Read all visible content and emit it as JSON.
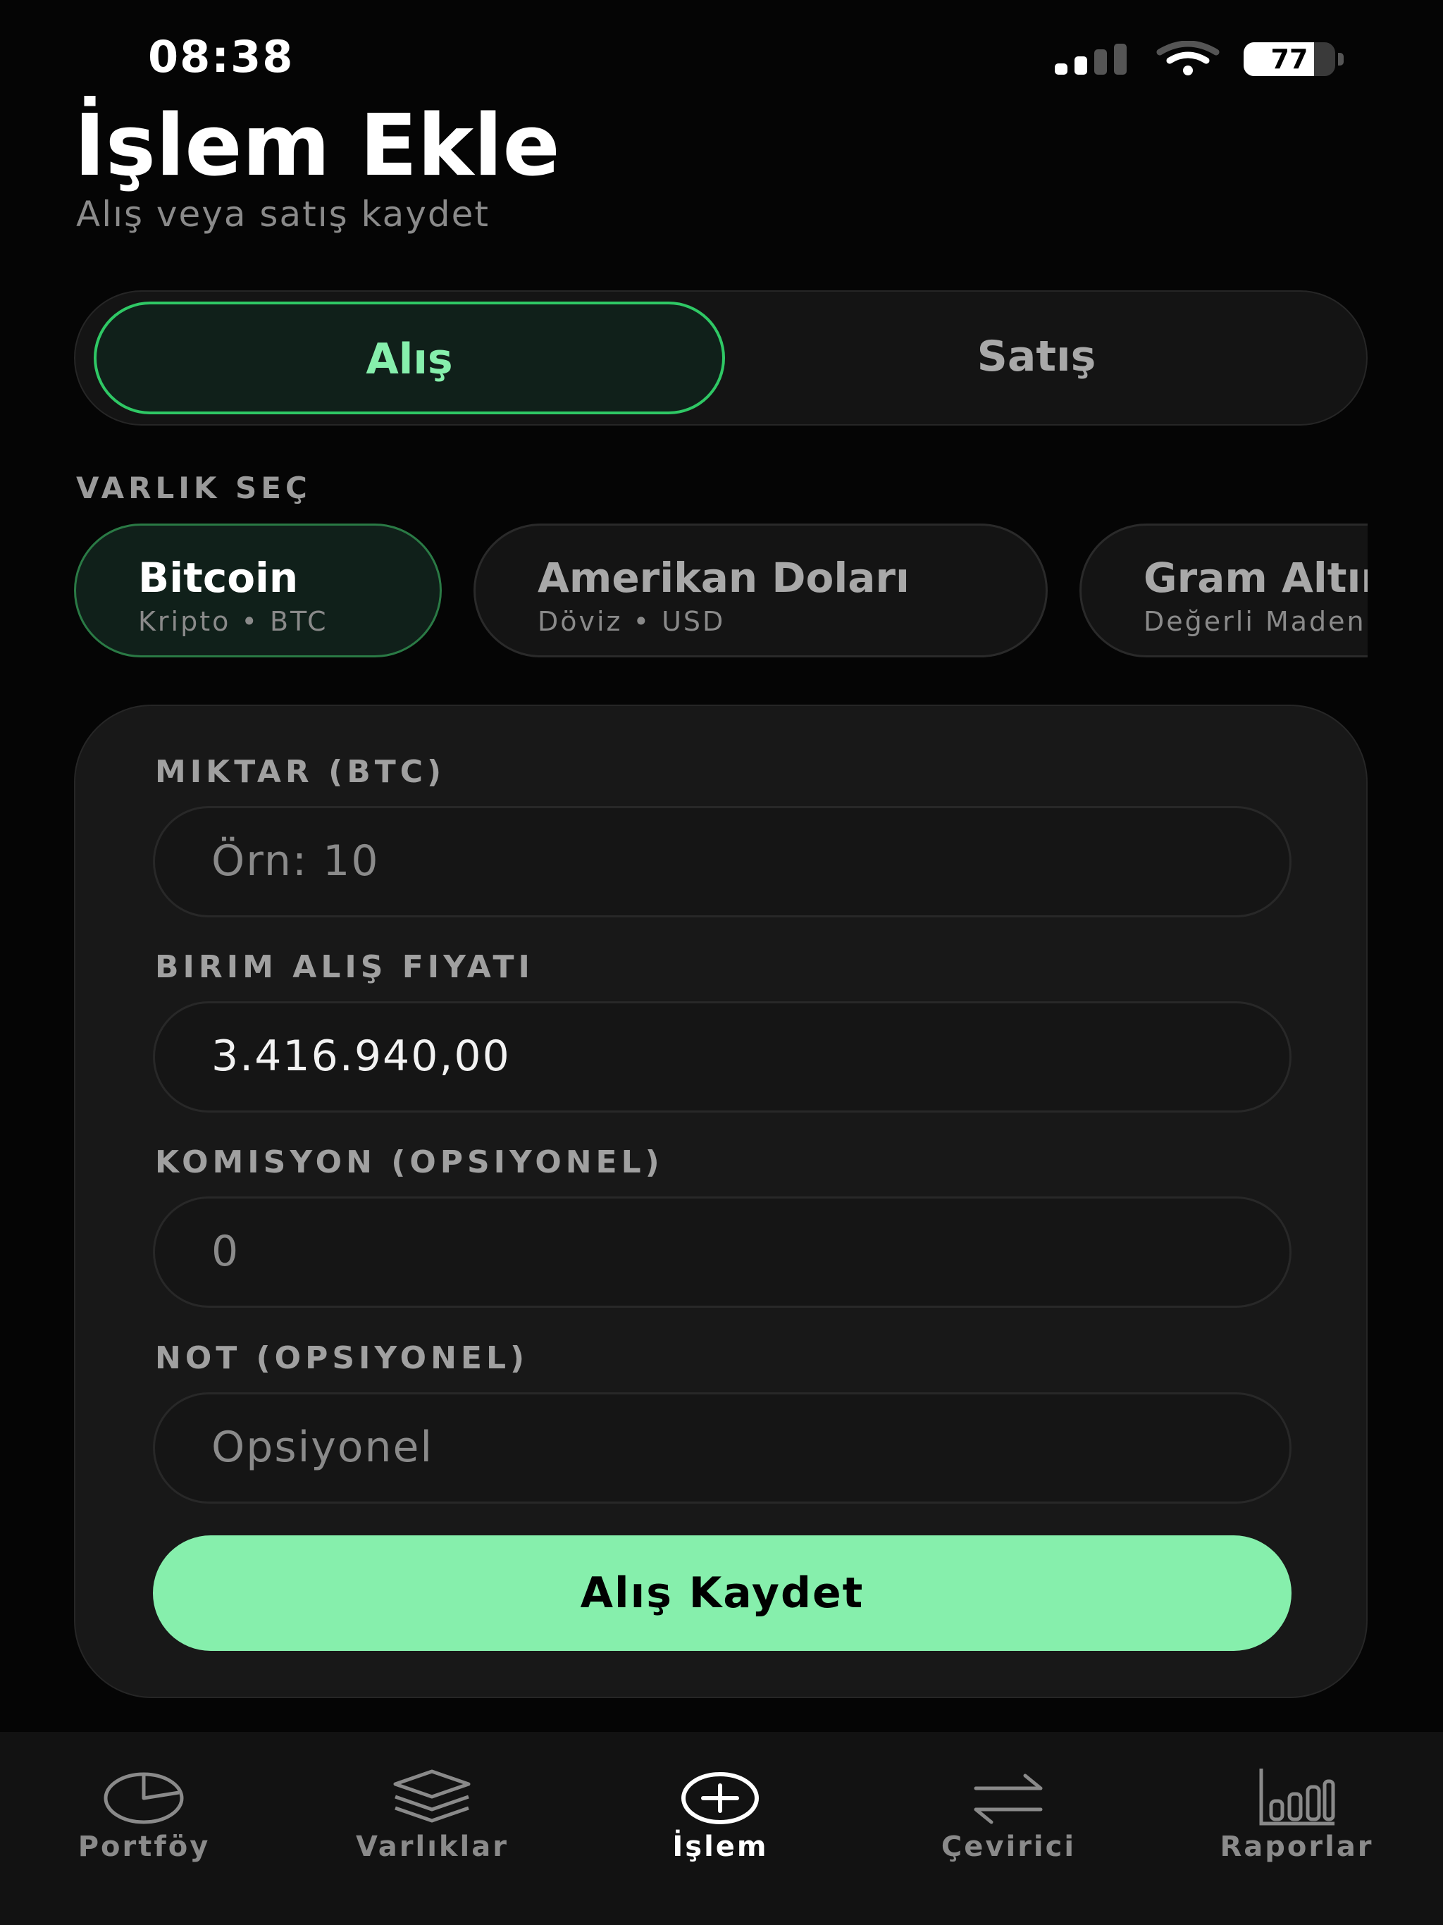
{
  "status_bar": {
    "time": "08:38",
    "battery": "77",
    "battery_level": 0.77
  },
  "header": {
    "title": "İşlem Ekle",
    "subtitle": "Alış veya satış kaydet"
  },
  "trade_type": {
    "buy_label": "Alış",
    "sell_label": "Satış",
    "selected": "buy"
  },
  "assets": {
    "section_label": "VARLIK SEÇ",
    "items": [
      {
        "name": "Bitcoin",
        "meta": "Kripto • BTC",
        "selected": true
      },
      {
        "name": "Amerikan Doları",
        "meta": "Döviz • USD",
        "selected": false
      },
      {
        "name": "Gram Altın",
        "meta": "Değerli Maden",
        "selected": false
      }
    ]
  },
  "form": {
    "amount": {
      "label": "MIKTAR (BTC)",
      "placeholder": "Örn: 10",
      "value": ""
    },
    "unit_price": {
      "label": "BIRIM ALIŞ FIYATI",
      "value": "3.416.940,00"
    },
    "commission": {
      "label": "KOMISYON (OPSIYONEL)",
      "placeholder": "0",
      "value": ""
    },
    "note": {
      "label": "NOT (OPSIYONEL)",
      "placeholder": "Opsiyonel",
      "value": ""
    },
    "submit_label": "Alış Kaydet"
  },
  "tab_bar": {
    "items": [
      {
        "label": "Portföy",
        "icon": "pie-chart-icon",
        "active": false
      },
      {
        "label": "Varlıklar",
        "icon": "layers-icon",
        "active": false
      },
      {
        "label": "İşlem",
        "icon": "plus-circle-icon",
        "active": true
      },
      {
        "label": "Çevirici",
        "icon": "swap-arrows-icon",
        "active": false
      },
      {
        "label": "Raporlar",
        "icon": "bar-chart-icon",
        "active": false
      }
    ]
  },
  "colors": {
    "accent": "#86efac",
    "accent_border": "#2fc865",
    "background": "#050505",
    "card": "#181818"
  }
}
